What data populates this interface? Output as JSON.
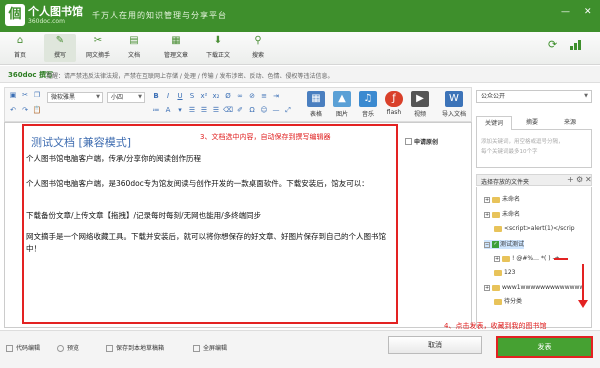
{
  "app": {
    "logo_char": "個",
    "name": "个人图书馆",
    "domain": "360doc.com",
    "slogan": "千万人在用的知识管理与分享平台",
    "window_controls": {
      "minimize": "—",
      "close": "✕"
    }
  },
  "toolbar": {
    "items": [
      {
        "label": "首页",
        "icon": "home-icon"
      },
      {
        "label": "撰写",
        "icon": "pen-icon"
      },
      {
        "label": "网文摘手",
        "icon": "scissors-icon"
      },
      {
        "label": "文档",
        "icon": "document-icon"
      },
      {
        "label": "管理文章",
        "icon": "manage-articles-icon"
      },
      {
        "label": "下载正文",
        "icon": "download-icon"
      },
      {
        "label": "搜索",
        "icon": "search-icon"
      }
    ]
  },
  "notice": {
    "brand": "360doc 撰写",
    "text": "提醒：请严禁违反法律法规，严禁在互联网上存储 / 处理 / 传输 / 发布涉密、反动、色情、侵权等违法信息。"
  },
  "editor_toolbar": {
    "font_family": "微软雅黑",
    "font_size": "小四",
    "big_tools": [
      {
        "label": "表格"
      },
      {
        "label": "图片"
      },
      {
        "label": "音乐"
      },
      {
        "label": "flash"
      },
      {
        "label": "视频"
      },
      {
        "label": "导入文档"
      }
    ]
  },
  "document": {
    "title": "测试文档 [兼容模式]",
    "paragraphs": [
      "个人图书馆电脑客户端，传承/分享你的阅读创作历程",
      "个人图书馆电脑客户端，是360doc专为馆友阅读与创作开发的一款桌面软件。下载安装后，馆友可以：",
      "下载备份文章/上传文章【拖拽】/记录每时每刻/无网也能用/多终端同步",
      "网文摘手是一个网络收藏工具。下载并安装后，就可以将你想保存的好文章、好图片保存到自己的个人图书馆中！"
    ],
    "original_label": "申请原创"
  },
  "annotations": {
    "step3": "3、文档选中内容，自动保存到撰写编辑器",
    "step4": "4、点击发表，收藏到我的图书馆"
  },
  "right_panel": {
    "visibility": "公众公开",
    "tabs": [
      "关键词",
      "摘要",
      "来源"
    ],
    "keyword_placeholder": [
      "添加关键词，用空格或逗号分隔，",
      "每个关键词最多10个字"
    ],
    "folder_header": "选择存放的文件夹",
    "folders": [
      "未命名",
      "未命名",
      "<script>alert(1)</scrip",
      "测试测试",
      "! @#%… *( ) -+",
      "123",
      "www1wwwwwwwwwwwww",
      "待分类"
    ]
  },
  "bottom": {
    "code_edit": "代码编辑",
    "preview": "预览",
    "save_draft": "保存到本地草稿箱",
    "full_edit": "全屏编辑",
    "cancel": "取消",
    "publish": "发表"
  },
  "colors": {
    "brand_green": "#3e8f2c",
    "annotation_red": "#e32222",
    "publish_green": "#46a132"
  }
}
